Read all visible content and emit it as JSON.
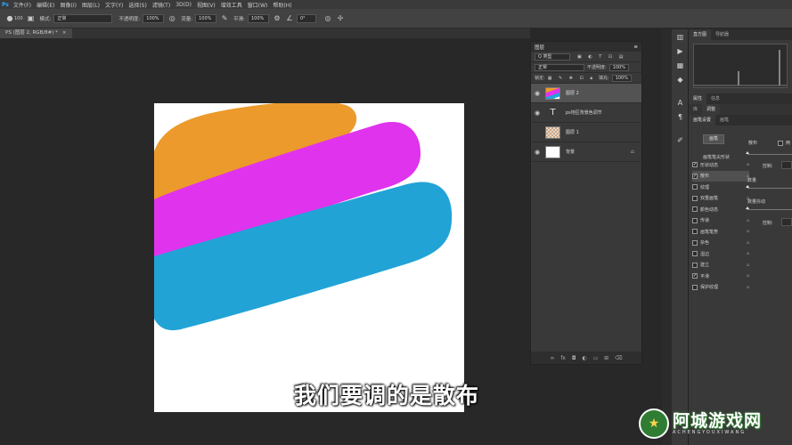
{
  "menu": [
    "文件(F)",
    "编辑(E)",
    "图像(I)",
    "图层(L)",
    "文字(Y)",
    "选择(S)",
    "滤镜(T)",
    "3D(D)",
    "视图(V)",
    "增效工具",
    "窗口(W)",
    "帮助(H)"
  ],
  "options": {
    "brush_size": "100",
    "mode_label": "模式:",
    "mode_value": "正常",
    "opacity_label": "不透明度:",
    "opacity_value": "100%",
    "flow_label": "流量:",
    "flow_value": "100%",
    "smooth_label": "平滑:",
    "smooth_value": "100%",
    "angle_value": "0°"
  },
  "doc_tab": {
    "label": "PS (图层 2, RGB/8#) *",
    "close": "×"
  },
  "subtitle": "我们要调的是散布",
  "layers_panel": {
    "title": "图层",
    "filter_label": "Q 类型",
    "blend_mode": "正常",
    "opacity_label": "不透明度:",
    "opacity_value": "100%",
    "lock_label": "锁定:",
    "fill_label": "填充:",
    "fill_value": "100%",
    "layers": [
      {
        "name": "图层 2",
        "selected": true,
        "kind": "stroke"
      },
      {
        "name": "ps地区背景色调节",
        "selected": false,
        "kind": "text"
      },
      {
        "name": "图层 1",
        "selected": false,
        "kind": "checker"
      },
      {
        "name": "背景",
        "selected": false,
        "kind": "white",
        "locked": true
      }
    ],
    "footer_icons": [
      "link-icon",
      "fx-icon",
      "mask-icon",
      "adjustment-icon",
      "folder-icon",
      "new-layer-icon",
      "trash-icon"
    ]
  },
  "right_panel": {
    "top_tabs": [
      "直方图",
      "导航器"
    ],
    "mid_tabs": [
      "属性",
      "信息"
    ],
    "sub_tabs": [
      "库",
      "调整"
    ],
    "brush_tabs": [
      "画笔设置",
      "画笔"
    ],
    "brushes_button": "画笔",
    "scatter_label": "散布",
    "both_axes_label": "两",
    "tip_shape_label": "画笔笔尖形状",
    "control_label": "控制:",
    "count_label": "数量",
    "count_jitter_label": "数量抖动",
    "control_label_2": "控制:",
    "brush_items": [
      {
        "label": "形状动态",
        "checked": true
      },
      {
        "label": "散布",
        "checked": true,
        "active": true
      },
      {
        "label": "纹理",
        "checked": false
      },
      {
        "label": "双重画笔",
        "checked": false
      },
      {
        "label": "颜色动态",
        "checked": false
      },
      {
        "label": "传递",
        "checked": false
      },
      {
        "label": "画笔笔势",
        "checked": false
      },
      {
        "label": "杂色",
        "checked": false
      },
      {
        "label": "湿边",
        "checked": false
      },
      {
        "label": "建立",
        "checked": false
      },
      {
        "label": "平滑",
        "checked": true
      },
      {
        "label": "保护纹理",
        "checked": false
      }
    ]
  },
  "watermark": {
    "title": "阿城游戏网",
    "subtitle": "ACHENGYOUXIWANG"
  },
  "colors": {
    "stroke_orange": "#ec9a2b",
    "stroke_magenta": "#e033ee",
    "stroke_blue": "#22a3d6",
    "ps_blue": "#31a8ff"
  }
}
